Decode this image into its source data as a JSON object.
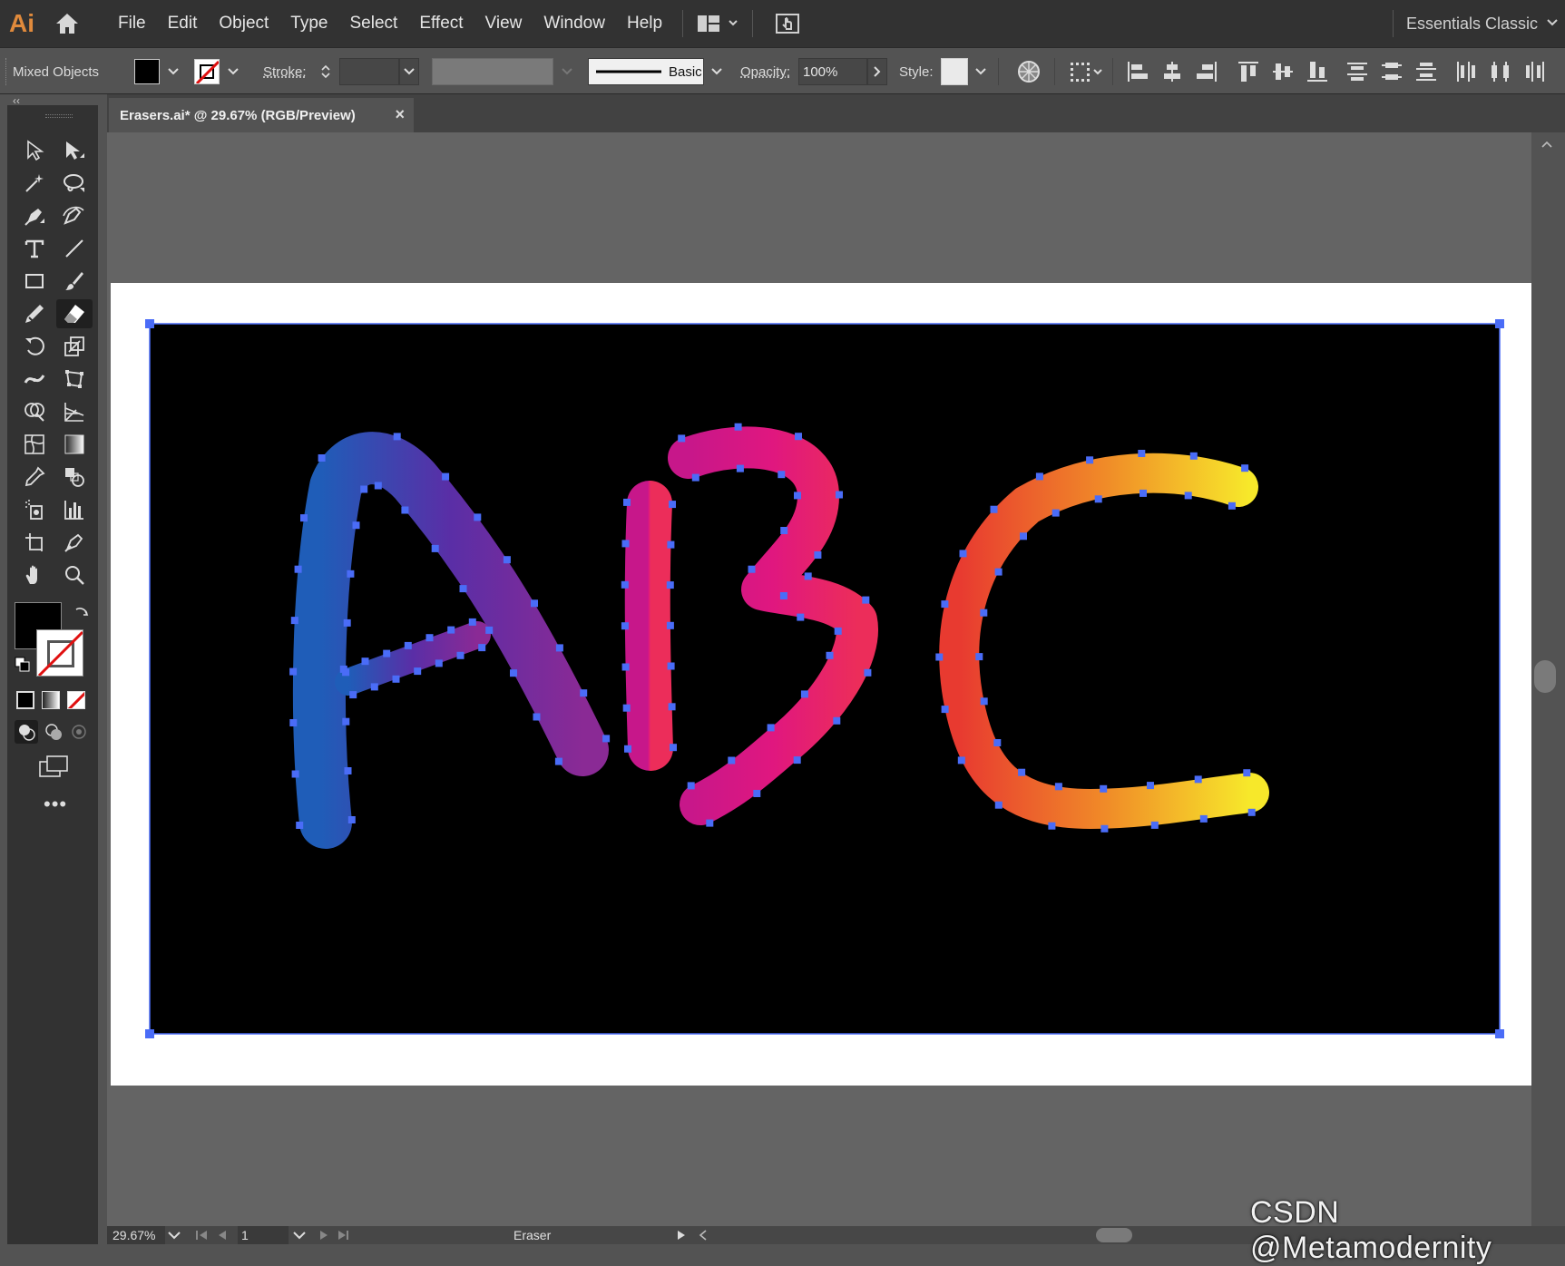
{
  "app": {
    "logo": "Ai",
    "accent": "#e08a3c",
    "menu": [
      "File",
      "Edit",
      "Object",
      "Type",
      "Select",
      "Effect",
      "View",
      "Window",
      "Help"
    ],
    "workspace": "Essentials Classic"
  },
  "control_bar": {
    "selection_label": "Mixed Objects",
    "fill_color": "#000000",
    "stroke_color": "none",
    "stroke_label": "Stroke:",
    "stroke_value": "",
    "brush_label": "Basic",
    "opacity_label": "Opacity:",
    "opacity_value": "100%",
    "style_label": "Style:",
    "icons": [
      "recolor-artwork-icon",
      "transform-grid-icon",
      "align-left-icon",
      "align-horizontal-center-icon",
      "align-right-icon",
      "align-top-icon",
      "align-vertical-center-icon",
      "align-bottom-icon",
      "distribute-top-icon",
      "distribute-vertical-center-icon",
      "distribute-bottom-icon",
      "distribute-left-icon",
      "distribute-horizontal-center-icon",
      "distribute-right-icon"
    ]
  },
  "document": {
    "tab_title": "Erasers.ai* @ 29.67% (RGB/Preview)",
    "close_glyph": "×",
    "artwork_text": "ABC",
    "letter_gradients": {
      "A": [
        "#1f5db8",
        "#5a2ea6",
        "#8a2a95"
      ],
      "B": [
        "#c7178a",
        "#e0177f",
        "#ec2d5a"
      ],
      "C": [
        "#e83a30",
        "#f08a28",
        "#f7e82a"
      ]
    },
    "anchor_color": "#4a6cf7"
  },
  "tools": [
    "selection-tool",
    "direct-selection-tool",
    "magic-wand-tool",
    "lasso-tool",
    "pen-tool",
    "curvature-tool",
    "type-tool",
    "line-tool",
    "rectangle-tool",
    "paintbrush-tool",
    "shaper-tool",
    "eraser-tool",
    "rotate-tool",
    "scale-tool",
    "width-tool",
    "free-transform-tool",
    "shape-builder-tool",
    "perspective-grid-tool",
    "mesh-tool",
    "gradient-tool",
    "eyedropper-tool",
    "blend-tool",
    "symbol-sprayer-tool",
    "column-graph-tool",
    "artboard-tool",
    "slice-tool",
    "hand-tool",
    "zoom-tool"
  ],
  "status": {
    "zoom": "29.67%",
    "artboard_number": "1",
    "current_tool": "Eraser"
  },
  "watermark": "CSDN @Metamodernity"
}
